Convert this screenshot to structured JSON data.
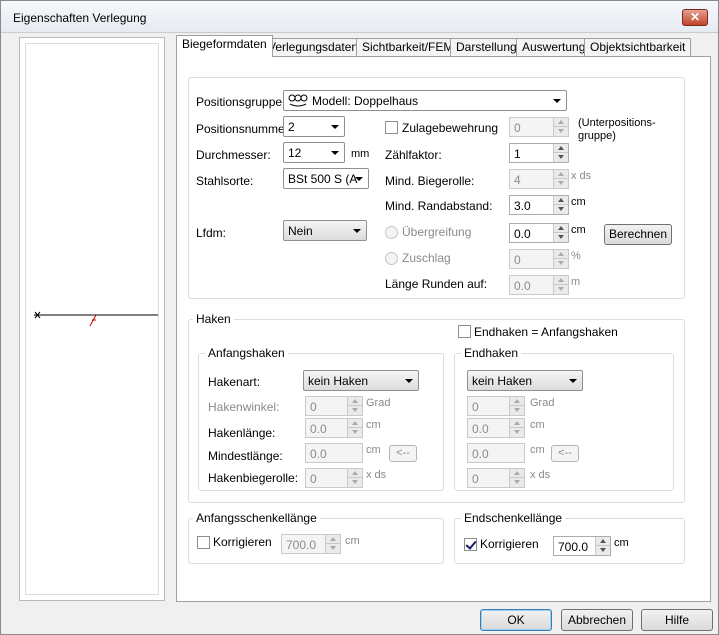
{
  "window": {
    "title": "Eigenschaften Verlegung",
    "close": "✕"
  },
  "tabs": [
    "Biegeformdaten",
    "Verlegungsdaten",
    "Sichtbarkeit/FEM",
    "Darstellung",
    "Auswertung",
    "Objektsichtbarkeit"
  ],
  "main": {
    "positionsgruppe_label": "Positionsgruppe:",
    "positionsgruppe_value": "Modell: Doppelhaus",
    "positionsnummer_label": "Positionsnummer:",
    "positionsnummer_value": "2",
    "durchmesser_label": "Durchmesser:",
    "durchmesser_value": "12",
    "durchmesser_unit": "mm",
    "stahlsorte_label": "Stahlsorte:",
    "stahlsorte_value": "BSt 500 S (A",
    "lfdm_label": "Lfdm:",
    "lfdm_value": "Nein",
    "zulage_label": "Zulagebewehrung",
    "zulage_value": "0",
    "unterpositions_line1": "(Unterpositions-",
    "unterpositions_line2": "gruppe)",
    "zaehlfaktor_label": "Zählfaktor:",
    "zaehlfaktor_value": "1",
    "mind_biegerolle_label": "Mind. Biegerolle:",
    "mind_biegerolle_value": "4",
    "mind_biegerolle_unit": "x ds",
    "mind_randabstand_label": "Mind. Randabstand:",
    "mind_randabstand_value": "3.0",
    "mind_randabstand_unit": "cm",
    "uebergreifung_label": "Übergreifung",
    "uebergreifung_value": "0.0",
    "uebergreifung_unit": "cm",
    "zuschlag_label": "Zuschlag",
    "zuschlag_value": "0",
    "zuschlag_unit": "%",
    "laenge_runden_label": "Länge Runden auf:",
    "laenge_runden_value": "0.0",
    "laenge_runden_unit": "m",
    "berechnen_label": "Berechnen"
  },
  "haken": {
    "title": "Haken",
    "endhaken_eq_label": "Endhaken = Anfangshaken",
    "anfang": {
      "title": "Anfangshaken",
      "hakenart_label": "Hakenart:",
      "hakenart_value": "kein Haken",
      "hakenwinkel_label": "Hakenwinkel:",
      "hakenwinkel_value": "0",
      "hakenwinkel_unit": "Grad",
      "hakenlaenge_label": "Hakenlänge:",
      "hakenlaenge_value": "0.0",
      "hakenlaenge_unit": "cm",
      "mindestlaenge_label": "Mindestlänge:",
      "mindestlaenge_value": "0.0",
      "mindestlaenge_unit": "cm",
      "arrow_label": "<--",
      "hakenbiegerolle_label": "Hakenbiegerolle:",
      "hakenbiegerolle_value": "0",
      "hakenbiegerolle_unit": "x ds"
    },
    "end": {
      "title": "Endhaken",
      "hakenart_value": "kein Haken",
      "hakenwinkel_value": "0",
      "hakenwinkel_unit": "Grad",
      "hakenlaenge_value": "0.0",
      "hakenlaenge_unit": "cm",
      "mindestlaenge_value": "0.0",
      "mindestlaenge_unit": "cm",
      "arrow_label": "<--",
      "hakenbiegerolle_value": "0",
      "hakenbiegerolle_unit": "x ds"
    }
  },
  "anfangsschenkel": {
    "title": "Anfangsschenkellänge",
    "korrigieren_label": "Korrigieren",
    "value": "700.0",
    "unit": "cm"
  },
  "endschenkel": {
    "title": "Endschenkellänge",
    "korrigieren_label": "Korrigieren",
    "value": "700.0",
    "unit": "cm"
  },
  "buttons": {
    "ok": "OK",
    "abbrechen": "Abbrechen",
    "hilfe": "Hilfe"
  },
  "icons": {
    "group": "chain-group-icon",
    "preview_marker": "bar-preview-icon"
  },
  "colors": {
    "accent": "#3c7fb1",
    "close": "#c0442a",
    "marker": "#cc0000"
  }
}
